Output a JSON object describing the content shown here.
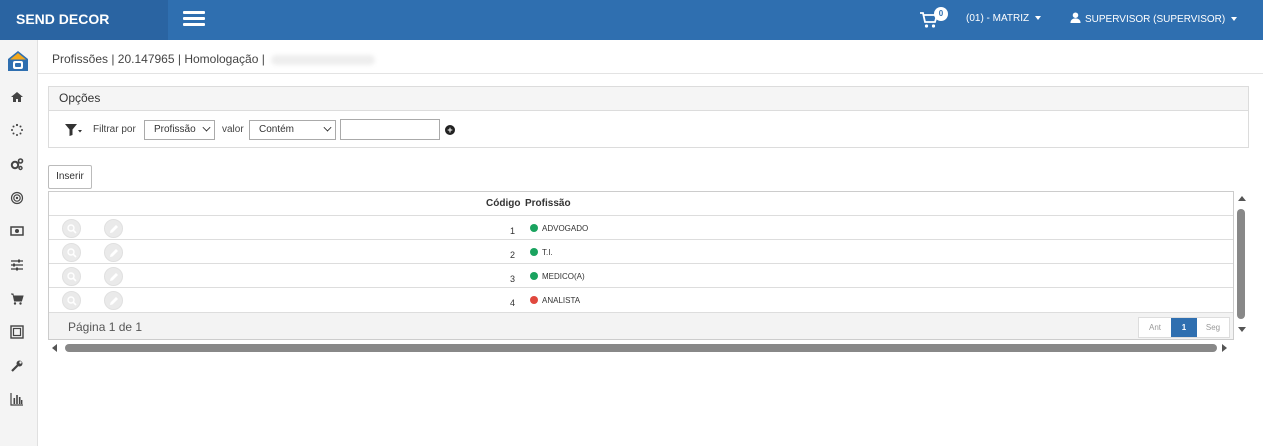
{
  "app": {
    "brand": "SEND DECOR"
  },
  "header": {
    "cart_count": "0",
    "company": "(01) - MATRIZ",
    "user": "SUPERVISOR (SUPERVISOR)"
  },
  "breadcrumb": "Profissões | 20.147965 | Homologação |",
  "options": {
    "title": "Opções",
    "filter_by_label": "Filtrar por",
    "filter_field": "Profissão",
    "value_label": "valor",
    "operator": "Contém",
    "value": ""
  },
  "toolbar": {
    "insert_label": "Inserir"
  },
  "grid": {
    "columns": {
      "code": "Código",
      "profession": "Profissão"
    },
    "rows": [
      {
        "code": "1",
        "name": "ADVOGADO",
        "status_color": "#1aa35f"
      },
      {
        "code": "2",
        "name": "T.I.",
        "status_color": "#1aa35f"
      },
      {
        "code": "3",
        "name": "MEDICO(A)",
        "status_color": "#1aa35f"
      },
      {
        "code": "4",
        "name": "ANALISTA",
        "status_color": "#e0483e"
      }
    ],
    "page_info": "Página 1 de 1",
    "pager": {
      "prev": "Ant",
      "current": "1",
      "next": "Seg"
    }
  },
  "sidebar_icons": [
    "home-icon",
    "spinner-icon",
    "cogs-icon",
    "target-icon",
    "money-icon",
    "sliders-icon",
    "cart-icon",
    "image-icon",
    "wrench-icon",
    "bar-chart-icon"
  ],
  "colors": {
    "primary": "#2f6fb0",
    "brand_bg": "#2a64a2",
    "active": "#1aa35f",
    "inactive": "#e0483e"
  }
}
